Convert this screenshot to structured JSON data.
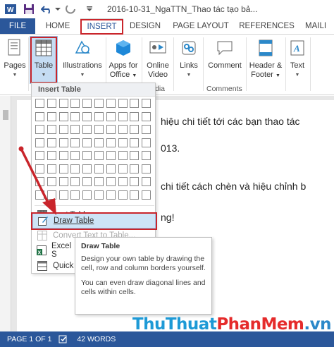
{
  "window": {
    "title": "2016-10-31_NgaTTN_Thao tác tạo bả..."
  },
  "tabs": [
    {
      "label": "FILE"
    },
    {
      "label": "HOME"
    },
    {
      "label": "INSERT"
    },
    {
      "label": "DESIGN"
    },
    {
      "label": "PAGE LAYOUT"
    },
    {
      "label": "REFERENCES"
    },
    {
      "label": "MAILI"
    }
  ],
  "ribbon": {
    "pages": "Pages",
    "table": "Table",
    "illustrations": "Illustrations",
    "apps_line1": "Apps for",
    "apps_line2": "Office",
    "online_line1": "Online",
    "online_line2": "Video",
    "media_group": "dia",
    "links": "Links",
    "comment": "Comment",
    "comments_group": "Comments",
    "header_line1": "Header &",
    "header_line2": "Footer",
    "text": "Text"
  },
  "dropdown": {
    "title": "Insert Table",
    "grid_columns": 10,
    "grid_rows": 8,
    "items": [
      {
        "label": "Insert Table...",
        "icon": "insert-table-icon",
        "visible_label": "nsert Table..."
      },
      {
        "label": "Draw Table",
        "icon": "draw-table-icon"
      },
      {
        "label": "Convert Text to Table...",
        "icon": "convert-text-icon",
        "visible_label": "Convert Text to Table..."
      },
      {
        "label": "Excel S",
        "icon": "excel-icon"
      },
      {
        "label": "Quick",
        "icon": "quick-tables-icon"
      }
    ]
  },
  "tooltip": {
    "title": "Draw Table",
    "desc1": "Design your own table by drawing the cell, row and column borders yourself.",
    "desc2": "You can even draw diagonal lines and cells within cells."
  },
  "document": {
    "line1": "hiệu chi tiết tới các bạn thao tác",
    "line2": "013.",
    "line3": "chi tiết cách chèn và hiệu chỉnh b",
    "line4": "ng!"
  },
  "status": {
    "page": "PAGE 1 OF 1",
    "words": "42 WORDS"
  },
  "watermark": {
    "part1": "ThuThuat",
    "part2": "PhanMem",
    "part3": ".vn"
  },
  "colors": {
    "accent": "#2b579a",
    "highlight_red": "#c9252b",
    "hover_blue": "#cde4f7"
  }
}
